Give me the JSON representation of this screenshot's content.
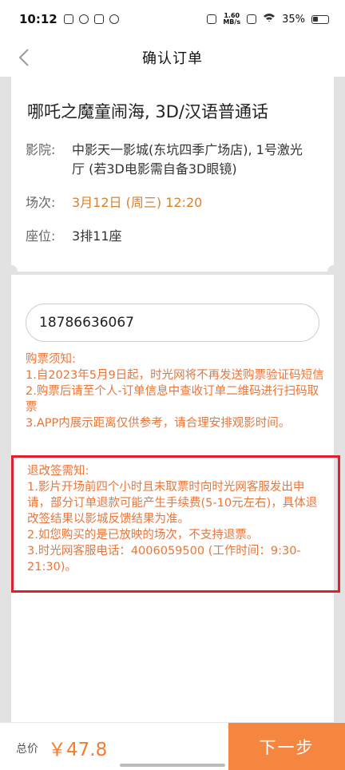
{
  "status_bar": {
    "time": "10:12",
    "net_speed_value": "1.60",
    "net_speed_unit": "MB/s",
    "battery": "35%"
  },
  "nav": {
    "title": "确认订单",
    "back_icon": "chevron-left-icon"
  },
  "order": {
    "movie_title": "哪吒之魔童闹海, 3D/汉语普通话",
    "cinema_label": "影院:",
    "cinema_value": "中影天一影城(东坑四季广场店), 1号激光厅 (若3D电影需自备3D眼镜)",
    "session_label": "场次:",
    "session_value": "3月12日 (周三)  12:20",
    "seat_label": "座位:",
    "seat_value": "3排11座"
  },
  "phone": {
    "value": "18786636067"
  },
  "purchase_notice": {
    "title": "购票须知:",
    "items": [
      "1.自2023年5月9日起，时光网将不再发送购票验证码短信",
      "2.购票后请至个人-订单信息中查收订单二维码进行扫码取票",
      "3.APP内展示距离仅供参考，请合理安排观影时间。"
    ]
  },
  "refund_notice": {
    "title": "退改签需知:",
    "items": [
      "1.影片开场前四个小时且未取票时向时光网客服发出申请，部分订单退款可能产生手续费(5-10元左右)，具体退改签结果以影城反馈结果为准。",
      "2.如您购买的是已放映的场次，不支持退票。",
      "3.时光网客服电话：4006059500 (工作时间：9:30-21:30)。"
    ],
    "frame_color": "#e0202c"
  },
  "footer": {
    "total_label": "总价",
    "total_price": "￥47.8",
    "next_button": "下一步",
    "accent_color": "#f5863f"
  }
}
